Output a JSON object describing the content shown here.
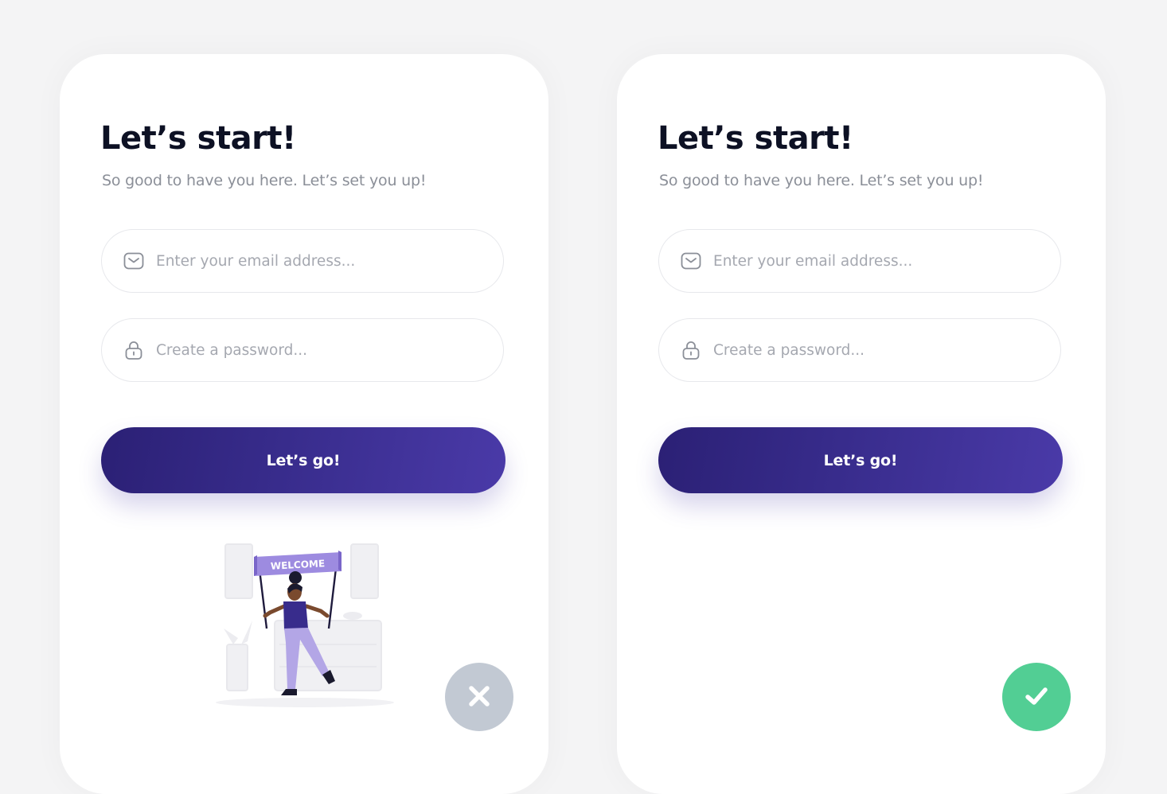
{
  "colors": {
    "page_background": "#f4f4f5",
    "card_background": "#ffffff",
    "title": "#0d1124",
    "subtitle": "#8b8f98",
    "placeholder": "#a5a8b0",
    "primary_gradient_start": "#2b2075",
    "primary_gradient_end": "#4a3aa8",
    "error_status": "#c2c9d3",
    "success_status": "#52ce94"
  },
  "cards": [
    {
      "title": "Let’s start!",
      "subtitle": "So good to have you here. Let’s set you up!",
      "email": {
        "icon": "mail-icon",
        "value": "",
        "placeholder": "Enter your email address..."
      },
      "password": {
        "icon": "lock-icon",
        "value": "",
        "placeholder": "Create a password..."
      },
      "submit_label": "Let’s go!",
      "illustration": {
        "icon": "welcome-banner-illustration",
        "banner_text": "WELCOME"
      },
      "status": {
        "state": "error",
        "icon": "close-icon"
      }
    },
    {
      "title": "Let’s start!",
      "subtitle": "So good to have you here. Let’s set you up!",
      "email": {
        "icon": "mail-icon",
        "value": "",
        "placeholder": "Enter your email address..."
      },
      "password": {
        "icon": "lock-icon",
        "value": "",
        "placeholder": "Create a password..."
      },
      "submit_label": "Let’s go!",
      "status": {
        "state": "success",
        "icon": "check-icon"
      }
    }
  ]
}
